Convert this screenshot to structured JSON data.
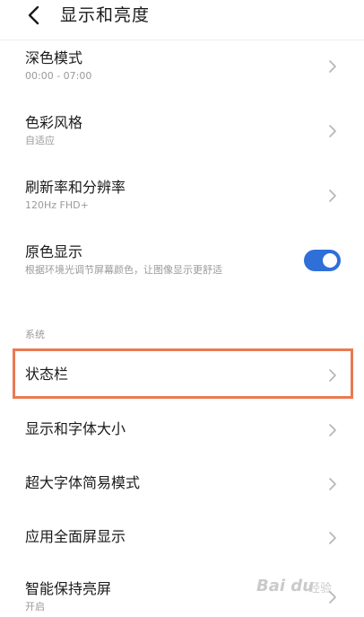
{
  "header": {
    "title": "显示和亮度",
    "back_icon": "chevron-left-icon"
  },
  "rows": [
    {
      "title": "深色模式",
      "subtitle": "00:00 - 07:00",
      "control": "chevron-right-icon"
    },
    {
      "title": "色彩风格",
      "subtitle": "自适应",
      "control": "chevron-right-icon"
    },
    {
      "title": "刷新率和分辨率",
      "subtitle": "120Hz  FHD+",
      "control": "chevron-right-icon"
    },
    {
      "title": "原色显示",
      "subtitle": "根据环境光调节屏幕颜色，让图像显示更舒适",
      "control": "toggle",
      "toggle_on": true
    }
  ],
  "section_system": {
    "label": "系统",
    "items": [
      {
        "title": "状态栏",
        "control": "chevron-right-icon",
        "highlighted": true
      },
      {
        "title": "显示和字体大小",
        "control": "chevron-right-icon"
      },
      {
        "title": "超大字体简易模式",
        "control": "chevron-right-icon"
      },
      {
        "title": "应用全面屏显示",
        "control": "chevron-right-icon"
      },
      {
        "title": "智能保持亮屏",
        "subtitle": "开启",
        "control": "chevron-right-icon"
      }
    ]
  },
  "colors": {
    "toggle_on": "#2f6fd8",
    "highlight_border": "#ea7a52",
    "secondary_text": "#9a9a9a"
  },
  "watermark": {
    "logo": "Bai du",
    "text": "经验"
  }
}
